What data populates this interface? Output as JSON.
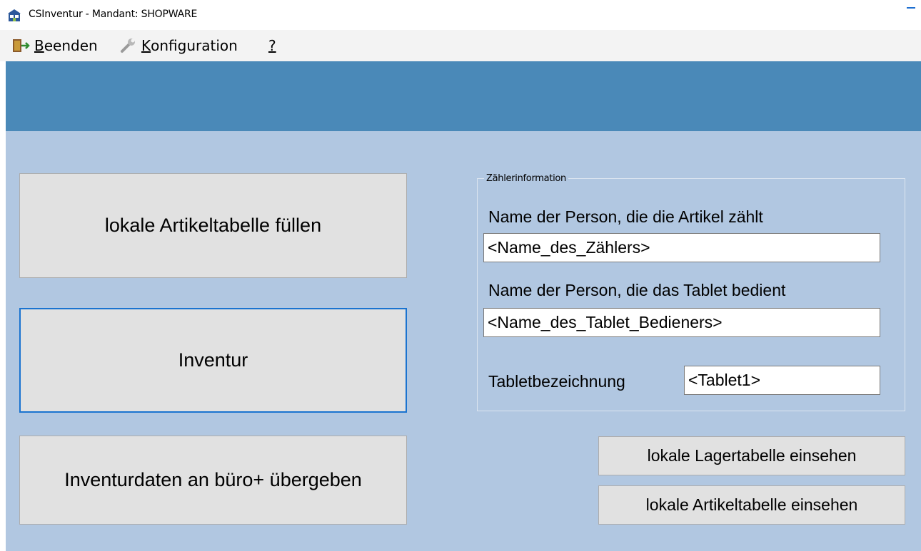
{
  "window": {
    "title": "CSInventur - Mandant: SHOPWARE",
    "icon": "building-icon"
  },
  "menu": {
    "items": [
      {
        "label_prefix": "",
        "underlined": "B",
        "rest": "eenden",
        "icon": "exit-door-icon"
      },
      {
        "label_prefix": "",
        "underlined": "K",
        "rest": "onfiguration",
        "icon": "wrench-icon"
      },
      {
        "label_prefix": "",
        "underlined": "?",
        "rest": "",
        "icon": ""
      }
    ]
  },
  "actions": {
    "fill_table": "lokale Artikeltabelle füllen",
    "inventory": "Inventur",
    "transfer": "Inventurdaten an büro+ übergeben"
  },
  "counter_info": {
    "legend": "Zählerinformation",
    "counter_label": "Name der Person, die die Artikel zählt",
    "counter_value": "<Name_des_Zählers>",
    "operator_label": "Name der Person, die das Tablet bedient",
    "operator_value": "<Name_des_Tablet_Bedieners>",
    "tablet_label": "Tabletbezeichnung",
    "tablet_value": "<Tablet1>"
  },
  "view_buttons": {
    "stock_table": "lokale Lagertabelle einsehen",
    "article_table": "lokale Artikeltabelle einsehen"
  },
  "colors": {
    "banner": "#4a89b8",
    "panel": "#b1c7e1",
    "button": "#e1e1e1",
    "focus": "#1a73d0"
  }
}
